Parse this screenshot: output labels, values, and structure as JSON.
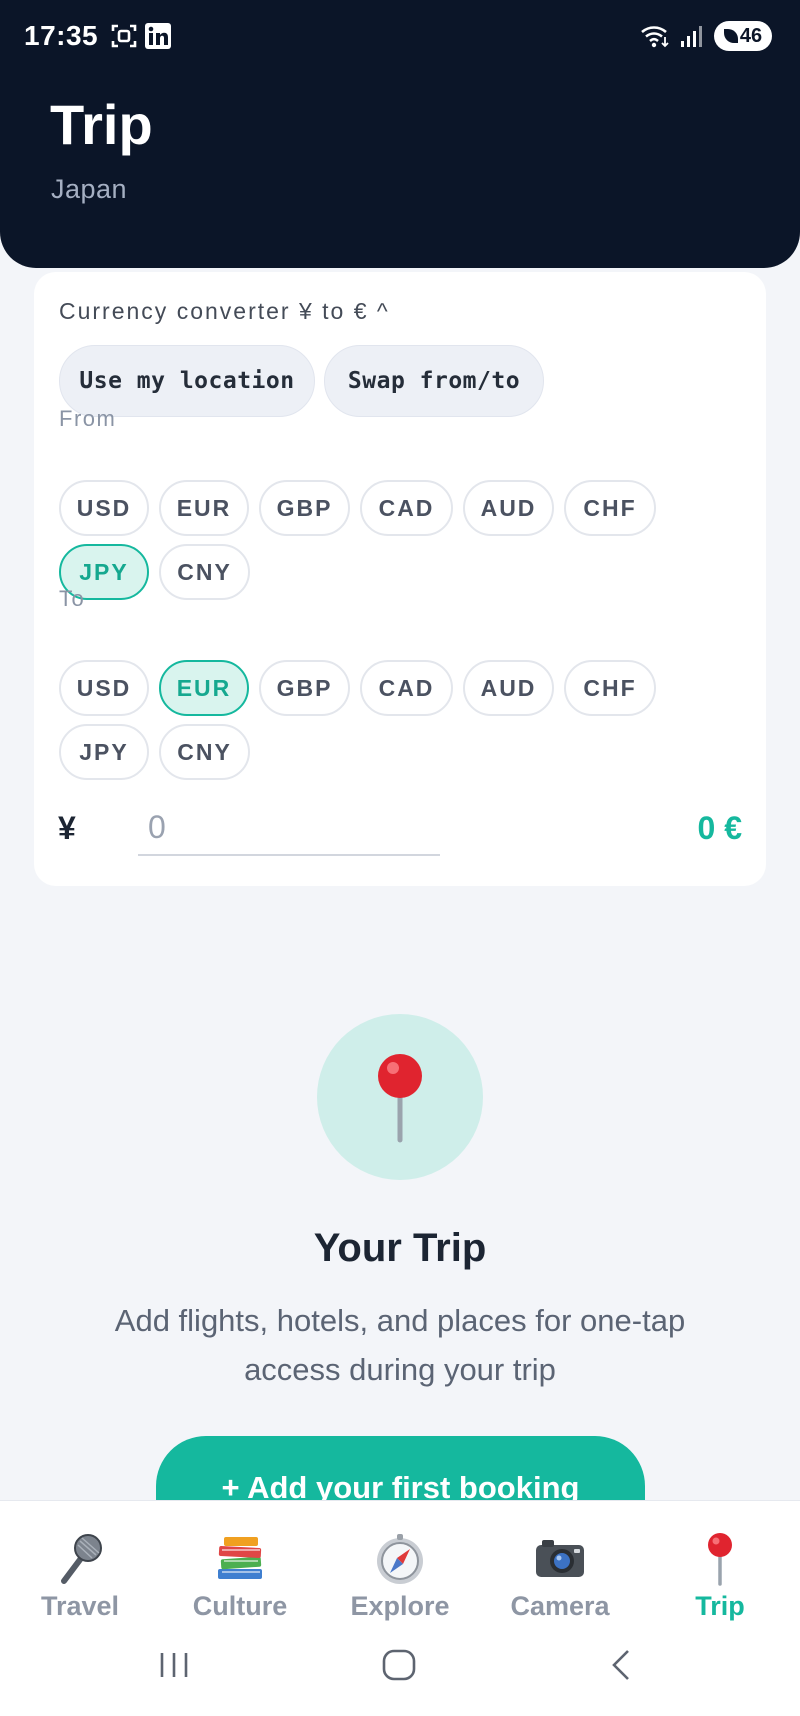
{
  "status_bar": {
    "time": "17:35",
    "battery": "46"
  },
  "header": {
    "title": "Trip",
    "subtitle": "Japan"
  },
  "converter": {
    "title": "Currency converter ¥ to € ^",
    "use_location_label": "Use my location",
    "swap_label": "Swap from/to",
    "from_label": "From",
    "to_label": "To",
    "from_currencies": [
      "USD",
      "EUR",
      "GBP",
      "CAD",
      "AUD",
      "CHF",
      "JPY",
      "CNY"
    ],
    "from_selected": "JPY",
    "to_currencies": [
      "USD",
      "EUR",
      "GBP",
      "CAD",
      "AUD",
      "CHF",
      "JPY",
      "CNY"
    ],
    "to_selected": "EUR",
    "input_symbol": "¥",
    "input_placeholder": "0",
    "result": "0 €"
  },
  "empty_state": {
    "icon": "pushpin-icon",
    "title": "Your Trip",
    "text": "Add flights, hotels, and places for one-tap access during your trip",
    "cta_label": "+ Add your first booking"
  },
  "nav": {
    "items": [
      {
        "label": "Travel",
        "icon": "microphone-icon"
      },
      {
        "label": "Culture",
        "icon": "books-icon"
      },
      {
        "label": "Explore",
        "icon": "compass-icon"
      },
      {
        "label": "Camera",
        "icon": "camera-icon"
      },
      {
        "label": "Trip",
        "icon": "pushpin-icon"
      }
    ],
    "active": "Trip"
  },
  "colors": {
    "header_bg": "#0b1528",
    "accent": "#15b89e",
    "selected_bg": "#d9f4ee",
    "page_bg": "#f3f5f9"
  }
}
